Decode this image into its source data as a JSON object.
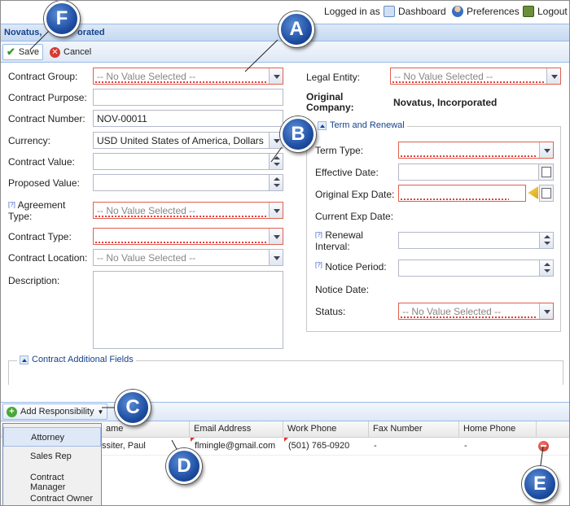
{
  "topbar": {
    "logged_in": "Logged in as",
    "dashboard": "Dashboard",
    "preferences": "Preferences",
    "logout": "Logout"
  },
  "window": {
    "title": "Novatus, Incorporated",
    "title_visible": "Novatus,",
    "title_visible2": "orated"
  },
  "toolbar": {
    "save": "Save",
    "cancel": "Cancel"
  },
  "form": {
    "contract_group": {
      "label": "Contract Group:",
      "placeholder": "-- No Value Selected --"
    },
    "contract_purpose": {
      "label": "Contract Purpose:",
      "value": ""
    },
    "contract_number": {
      "label": "Contract Number:",
      "value": "NOV-00011"
    },
    "currency": {
      "label": "Currency:",
      "value": "USD United States of America, Dollars"
    },
    "contract_value": {
      "label": "Contract Value:",
      "value": ""
    },
    "proposed_value": {
      "label": "Proposed Value:",
      "value": ""
    },
    "agreement_type": {
      "hint": "[?]",
      "label1": "Agreement",
      "label2": "Type:",
      "placeholder": "-- No Value Selected --"
    },
    "contract_type": {
      "label": "Contract Type:",
      "value": ""
    },
    "contract_location": {
      "label": "Contract Location:",
      "placeholder": "-- No Value Selected --"
    },
    "description": {
      "label": "Description:",
      "value": ""
    },
    "legal_entity": {
      "label": "Legal Entity:",
      "placeholder": "-- No Value Selected --"
    },
    "original_company": {
      "label1": "Original",
      "label2": "Company:",
      "value": "Novatus, Incorporated"
    }
  },
  "term": {
    "legend": "Term and Renewal",
    "term_type": {
      "label": "Term Type:"
    },
    "effective_date": {
      "label": "Effective Date:"
    },
    "original_exp_date": {
      "label": "Original Exp Date:"
    },
    "current_exp_date": {
      "label": "Current Exp Date:"
    },
    "renewal_interval": {
      "hint": "[?]",
      "label1": "Renewal",
      "label2": "Interval:"
    },
    "notice_period": {
      "hint": "[?]",
      "label": "Notice Period:"
    },
    "notice_date": {
      "label": "Notice Date:"
    },
    "status": {
      "label": "Status:",
      "placeholder": "-- No Value Selected --"
    }
  },
  "additional": {
    "legend": "Contract Additional Fields"
  },
  "grid": {
    "add_button": "Add Responsibility",
    "columns": [
      "Name",
      "Email Address",
      "Work Phone",
      "Fax Number",
      "Home Phone"
    ],
    "name_visible": "ame",
    "row": {
      "name": "ssiter, Paul",
      "email": "flmingle@gmail.com",
      "work": "(501) 765-0920",
      "fax": "-",
      "home": "-"
    }
  },
  "menu": {
    "items": [
      "Attorney",
      "Sales Rep",
      "Contract Manager",
      "Contract Owner"
    ]
  },
  "callouts": {
    "a": "A",
    "b": "B",
    "c": "C",
    "d": "D",
    "e": "E",
    "f": "F"
  },
  "colors": {
    "header_blue": "#15428b",
    "callout_blue": "#1f4fa3",
    "invalid": "#e04040"
  }
}
